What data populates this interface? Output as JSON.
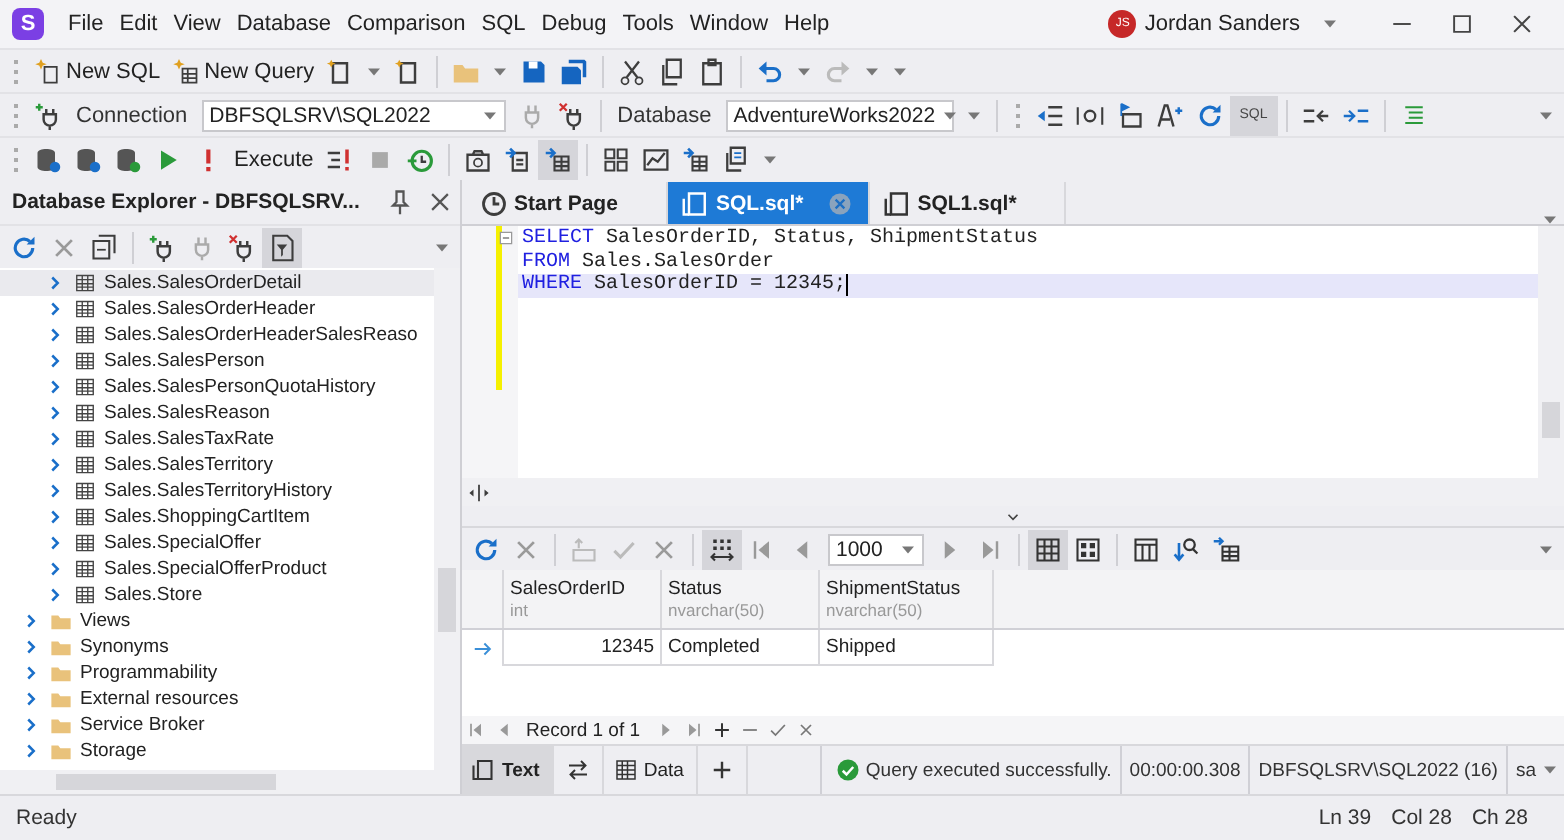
{
  "app": {
    "logo": "S"
  },
  "menu": [
    "File",
    "Edit",
    "View",
    "Database",
    "Comparison",
    "SQL",
    "Debug",
    "Tools",
    "Window",
    "Help"
  ],
  "user": {
    "initials": "JS",
    "name": "Jordan Sanders"
  },
  "toolbar": {
    "new_sql": "New SQL",
    "new_query": "New Query",
    "connection_label": "Connection",
    "connection": "DBFSQLSRV\\SQL2022",
    "database_label": "Database",
    "database": "AdventureWorks2022",
    "sql_toggle": "SQL",
    "execute": "Execute"
  },
  "explorer": {
    "title": "Database Explorer - DBFSQLSRV...",
    "items": [
      {
        "kind": "table",
        "label": "Sales.SalesOrderDetail",
        "expanded": false,
        "selected": true
      },
      {
        "kind": "table",
        "label": "Sales.SalesOrderHeader",
        "expanded": false,
        "selected": false
      },
      {
        "kind": "table",
        "label": "Sales.SalesOrderHeaderSalesReaso",
        "expanded": false,
        "selected": false
      },
      {
        "kind": "table",
        "label": "Sales.SalesPerson",
        "expanded": false,
        "selected": false
      },
      {
        "kind": "table",
        "label": "Sales.SalesPersonQuotaHistory",
        "expanded": false,
        "selected": false
      },
      {
        "kind": "table",
        "label": "Sales.SalesReason",
        "expanded": false,
        "selected": false
      },
      {
        "kind": "table",
        "label": "Sales.SalesTaxRate",
        "expanded": false,
        "selected": false
      },
      {
        "kind": "table",
        "label": "Sales.SalesTerritory",
        "expanded": false,
        "selected": false
      },
      {
        "kind": "table",
        "label": "Sales.SalesTerritoryHistory",
        "expanded": false,
        "selected": false
      },
      {
        "kind": "table",
        "label": "Sales.ShoppingCartItem",
        "expanded": false,
        "selected": false
      },
      {
        "kind": "table",
        "label": "Sales.SpecialOffer",
        "expanded": false,
        "selected": false
      },
      {
        "kind": "table",
        "label": "Sales.SpecialOfferProduct",
        "expanded": false,
        "selected": false
      },
      {
        "kind": "table",
        "label": "Sales.Store",
        "expanded": false,
        "selected": false
      },
      {
        "kind": "folder",
        "label": "Views",
        "expanded": false,
        "selected": false
      },
      {
        "kind": "folder",
        "label": "Synonyms",
        "expanded": false,
        "selected": false
      },
      {
        "kind": "folder",
        "label": "Programmability",
        "expanded": false,
        "selected": false
      },
      {
        "kind": "folder",
        "label": "External resources",
        "expanded": false,
        "selected": false
      },
      {
        "kind": "folder",
        "label": "Service Broker",
        "expanded": false,
        "selected": false
      },
      {
        "kind": "folder",
        "label": "Storage",
        "expanded": false,
        "selected": false
      }
    ]
  },
  "tabs": [
    {
      "label": "Start Page",
      "kind": "start",
      "selected": false
    },
    {
      "label": "SQL.sql*",
      "kind": "sql",
      "selected": true
    },
    {
      "label": "SQL1.sql*",
      "kind": "sql",
      "selected": false
    }
  ],
  "editor": {
    "lines": [
      {
        "current": false,
        "tokens": [
          {
            "kind": "keyword",
            "text": "SELECT"
          },
          {
            "kind": "plain",
            "text": " SalesOrderID, Status, ShipmentStatus"
          }
        ]
      },
      {
        "current": false,
        "tokens": [
          {
            "kind": "keyword",
            "text": "FROM"
          },
          {
            "kind": "plain",
            "text": " Sales.SalesOrder"
          }
        ]
      },
      {
        "current": true,
        "tokens": [
          {
            "kind": "keyword",
            "text": "WHERE"
          },
          {
            "kind": "plain",
            "text": " SalesOrderID = 12345;"
          }
        ]
      }
    ]
  },
  "results": {
    "page_size": "1000",
    "columns": [
      {
        "name": "SalesOrderID",
        "type": "int",
        "kind": "number"
      },
      {
        "name": "Status",
        "type": "nvarchar(50)",
        "kind": "text"
      },
      {
        "name": "ShipmentStatus",
        "type": "nvarchar(50)",
        "kind": "text"
      }
    ],
    "rows": [
      {
        "selected": true,
        "cells": [
          "12345",
          "Completed",
          "Shipped"
        ]
      }
    ],
    "record": "Record 1 of 1"
  },
  "bottom_tabs": [
    {
      "label": "Text",
      "kind": "text",
      "selected": true
    },
    {
      "label": "Data",
      "kind": "data",
      "selected": false
    }
  ],
  "query_status": {
    "message": "Query executed successfully.",
    "time": "00:00:00.308",
    "server": "DBFSQLSRV\\SQL2022 (16)",
    "user": "sa"
  },
  "status_bar": {
    "text": "Ready",
    "ln": "Ln 39",
    "col": "Col 28",
    "ch": "Ch 28"
  }
}
